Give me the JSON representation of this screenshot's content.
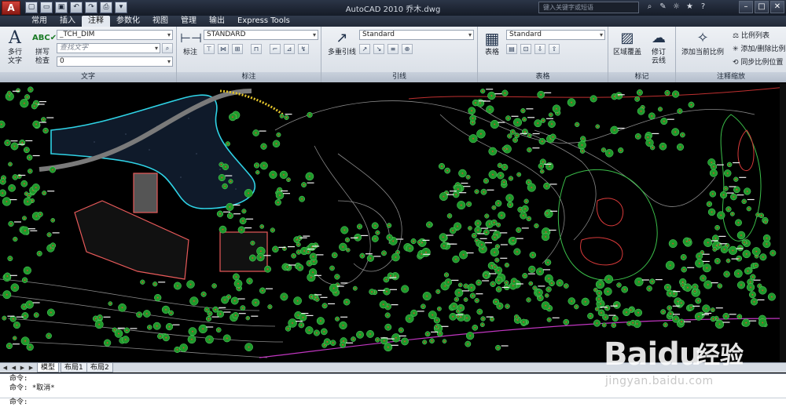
{
  "title_bar": {
    "app_logo": "A",
    "title": "AutoCAD 2010    乔木.dwg",
    "search_placeholder": "键入关键字或短语",
    "win_min": "–",
    "win_max": "□",
    "win_close": "✕"
  },
  "quick_access": [
    "▢",
    "▭",
    "▣",
    "↶",
    "↷",
    "⎙",
    "▾"
  ],
  "ribbon_tabs": [
    {
      "label": "常用",
      "active": false
    },
    {
      "label": "插入",
      "active": false
    },
    {
      "label": "注释",
      "active": true
    },
    {
      "label": "参数化",
      "active": false
    },
    {
      "label": "视图",
      "active": false
    },
    {
      "label": "管理",
      "active": false
    },
    {
      "label": "输出",
      "active": false
    },
    {
      "label": "Express Tools",
      "active": false
    }
  ],
  "panel_text": {
    "title": "文字",
    "multiline_text_line1": "多行",
    "multiline_text_line2": "文字",
    "spellcheck_line1": "拼写",
    "spellcheck_line2": "检查",
    "text_style": "_TCH_DIM",
    "find_text_placeholder": "查找文字",
    "text_height": "0"
  },
  "panel_dim": {
    "title": "标注",
    "dimension_label": "标注",
    "dim_style": "STANDARD"
  },
  "panel_leader": {
    "title": "引线",
    "multileader_label": "多重引线",
    "leader_style": "Standard"
  },
  "panel_table": {
    "title": "表格",
    "table_label": "表格",
    "table_style": "Standard"
  },
  "panel_markup": {
    "title": "标记",
    "wipeout_label": "区域覆盖",
    "revcloud_line1": "修订",
    "revcloud_line2": "云线"
  },
  "panel_scale": {
    "title": "注释缩放",
    "add_current_scale": "添加当前比例",
    "scale_list": "比例列表",
    "add_delete_scales": "添加/删除比例",
    "sync_scale_positions": "同步比例位置"
  },
  "layout_tabs": [
    {
      "label": "模型",
      "active": true
    },
    {
      "label": "布局1",
      "active": false
    },
    {
      "label": "布局2",
      "active": false
    }
  ],
  "command_history": [
    "命令:",
    "命令: *取消*"
  ],
  "command_prompt": "命令:",
  "watermark": {
    "logo": "Baidu",
    "text": "经验",
    "url": "jingyan.baidu.com"
  },
  "colors": {
    "tree_fill": "#1f9a2c",
    "tree_center": "#e8442b",
    "contour": "#9a9a9a",
    "pond_edge": "#2fd3e6",
    "building": "#e85a5a",
    "boundary": "#cc33cc",
    "label": "#f2f2f2"
  }
}
